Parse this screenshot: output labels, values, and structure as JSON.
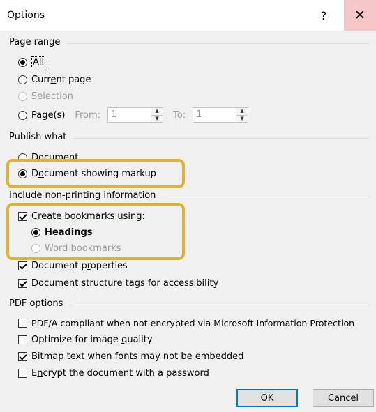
{
  "window": {
    "title": "Options",
    "help_glyph": "?",
    "close_glyph": "✕"
  },
  "page_range": {
    "label": "Page range",
    "all": "All",
    "current_page": {
      "pre": "Curr",
      "accel": "e",
      "post": "nt page"
    },
    "selection": "Selection",
    "pages": {
      "pre": "Pa",
      "accel": "g",
      "post": "e(s)"
    },
    "from_label": "From:",
    "from_value": "1",
    "to_label": "To:",
    "to_value": "1"
  },
  "publish_what": {
    "label": "Publish what",
    "document": "Document",
    "showing_markup": {
      "pre": "D",
      "accel": "o",
      "post": "cument showing markup"
    }
  },
  "non_printing": {
    "label": "Include non-printing information",
    "create_bookmarks": {
      "accel": "C",
      "post": "reate bookmarks using:"
    },
    "headings": {
      "accel": "H",
      "post": "eadings"
    },
    "word_bookmarks": "Word bookmarks",
    "doc_properties": {
      "pre": "Document p",
      "accel": "r",
      "post": "operties"
    },
    "structure_tags": {
      "pre": "Docu",
      "accel": "m",
      "post": "ent structure tags for accessibility"
    }
  },
  "pdf_options": {
    "label": "PDF options",
    "pdfa": "PDF/A compliant when not encrypted via Microsoft Information Protection",
    "optimize": {
      "pre": "Optimize for image ",
      "accel": "q",
      "post": "uality"
    },
    "bitmap": "Bitmap text when fonts may not be embedded",
    "encrypt": {
      "pre": "E",
      "accel": "n",
      "post": "crypt the document with a password"
    }
  },
  "buttons": {
    "ok": "OK",
    "cancel": "Cancel"
  },
  "colors": {
    "highlight": "#e1b32f",
    "close_hover": "#f7c6c9",
    "default_button_border": "#0078d7"
  },
  "icons": {
    "help": "question-mark-icon",
    "close": "close-icon",
    "spin_up": "arrow-up-icon",
    "spin_down": "arrow-down-icon"
  }
}
